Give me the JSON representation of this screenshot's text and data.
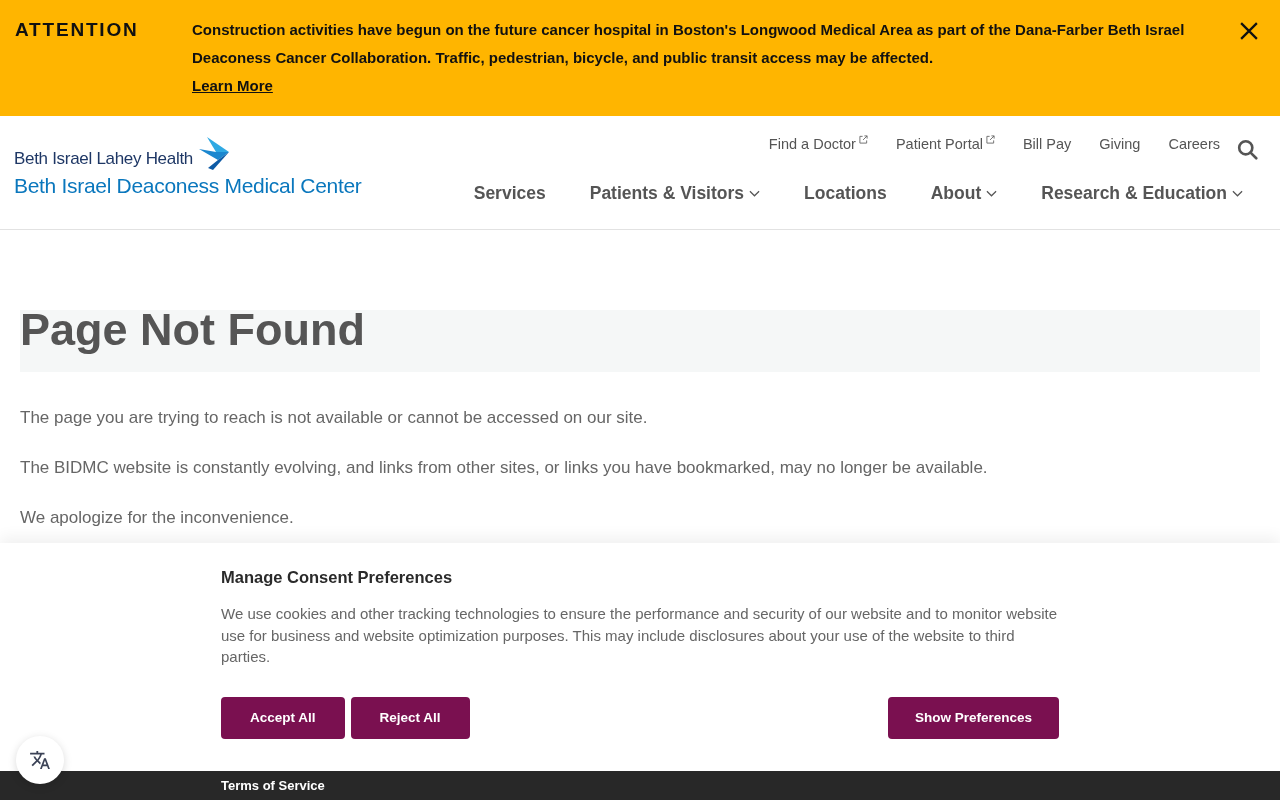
{
  "alert": {
    "label": "ATTENTION",
    "message": "Construction activities have begun on the future cancer hospital in Boston's Longwood Medical Area as part of the Dana-Farber Beth Israel Deaconess Cancer Collaboration. Traffic, pedestrian, bicycle, and public transit access may be affected.",
    "link": "Learn More"
  },
  "header": {
    "logo": {
      "parent_name": "Beth Israel Lahey Health",
      "name": "Beth Israel Deaconess Medical Center"
    },
    "utility_links": [
      {
        "label": "Find a Doctor",
        "external": true
      },
      {
        "label": "Patient Portal",
        "external": true
      },
      {
        "label": "Bill Pay",
        "external": false
      },
      {
        "label": "Giving",
        "external": false
      },
      {
        "label": "Careers",
        "external": false
      }
    ],
    "nav": [
      {
        "label": "Services",
        "has_menu": false
      },
      {
        "label": "Patients & Visitors",
        "has_menu": true
      },
      {
        "label": "Locations",
        "has_menu": false
      },
      {
        "label": "About",
        "has_menu": true
      },
      {
        "label": "Research & Education",
        "has_menu": true
      }
    ]
  },
  "main": {
    "title": "Page Not Found",
    "paragraphs": [
      "The page you are trying to reach is not available or cannot be accessed on our site.",
      "The BIDMC website is constantly evolving, and links from other sites, or links you have bookmarked, may no longer be available.",
      "We apologize for the inconvenience."
    ]
  },
  "cookie_banner": {
    "title": "Manage Consent Preferences",
    "text": "We use cookies and other tracking technologies to ensure the performance and security of our website and to monitor website use for business and website optimization purposes. This may include disclosures about your use of the website to third parties.",
    "actions": [
      "Accept All",
      "Reject All"
    ],
    "preferences_button": "Show Preferences",
    "footer_link": "Terms of Service"
  }
}
